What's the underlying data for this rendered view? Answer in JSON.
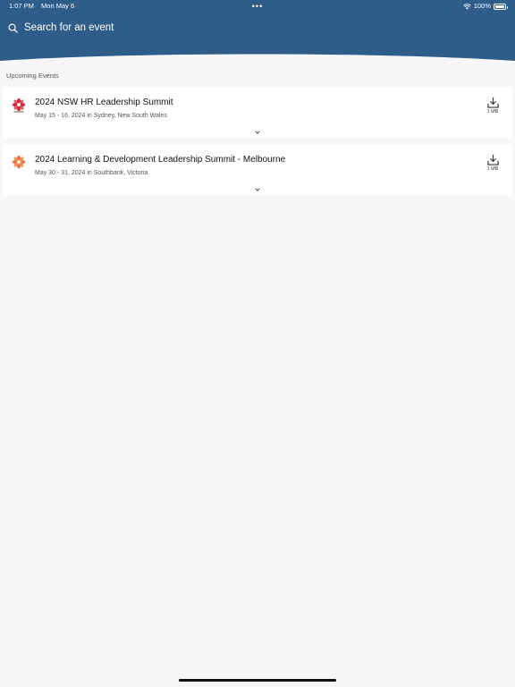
{
  "status_bar": {
    "time": "1:07 PM",
    "date": "Mon May 6",
    "dots": "•••",
    "battery_level": "100%",
    "battery_fill": 1.0
  },
  "search": {
    "placeholder": "Search for an event"
  },
  "section": {
    "title": "Upcoming Events"
  },
  "events": [
    {
      "title": "2024 NSW HR Leadership Summit",
      "subtitle": "May 15 - 16, 2024 in Sydney, New South Wales",
      "download_size": "1 MB",
      "logo_color": "#d62a3a"
    },
    {
      "title": "2024 Learning & Development Leadership Summit - Melbourne",
      "subtitle": "May 30 - 31, 2024 in Southbank, Victoria",
      "download_size": "1 MB",
      "logo_color": "#e8763a"
    }
  ],
  "colors": {
    "header": "#2e5d8a",
    "background": "#f6f6f6"
  }
}
